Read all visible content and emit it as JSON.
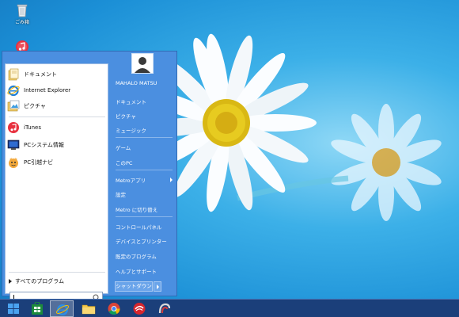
{
  "desktop": {
    "icons": [
      {
        "label": "ごみ箱",
        "icon": "recycle-bin-icon"
      },
      {
        "label": "iTunes",
        "icon": "itunes-icon"
      }
    ]
  },
  "start_menu": {
    "left": {
      "items": [
        {
          "label": "ドキュメント",
          "icon": "documents-icon"
        },
        {
          "label": "Internet Explorer",
          "icon": "internet-explorer-icon"
        },
        {
          "label": "ピクチャ",
          "icon": "pictures-icon"
        },
        {
          "label": "iTunes",
          "icon": "itunes-icon"
        },
        {
          "label": "PCシステム情報",
          "icon": "pc-system-info-icon"
        },
        {
          "label": "PC引越ナビ",
          "icon": "pc-moving-navi-icon"
        }
      ],
      "all_programs": "すべてのプログラム",
      "search_placeholder": ""
    },
    "right": {
      "user_name": "MAHALO MATSU",
      "items": [
        "ドキュメント",
        "ピクチャ",
        "ミュージック",
        "ゲーム",
        "このPC",
        "Metroアプリ",
        "設定",
        "Metro に切り替え",
        "コントロールパネル",
        "デバイスとプリンター",
        "既定のプログラム",
        "ヘルプとサポート"
      ],
      "shutdown_label": "シャットダウン"
    }
  },
  "taskbar": {
    "buttons": [
      {
        "icon": "start-windows-icon"
      },
      {
        "icon": "store-icon"
      },
      {
        "icon": "internet-explorer-icon",
        "active": true
      },
      {
        "icon": "file-explorer-icon"
      },
      {
        "icon": "chrome-icon"
      },
      {
        "icon": "security-app-icon"
      },
      {
        "icon": "app-icon"
      }
    ]
  },
  "colors": {
    "accent": "#4b8fe0",
    "taskbar": "#1b3f7a"
  }
}
